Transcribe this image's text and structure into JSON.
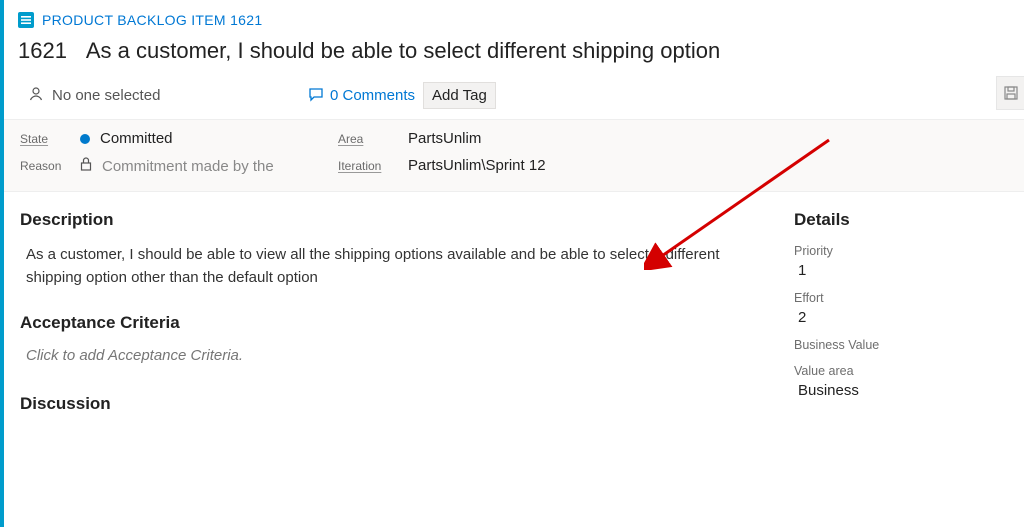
{
  "header": {
    "type_label": "PRODUCT BACKLOG ITEM",
    "id": "1621",
    "title": "As a customer, I should be able to select different shipping option"
  },
  "meta": {
    "assignee": "No one selected",
    "comments": "0 Comments",
    "add_tag": "Add Tag"
  },
  "fields": {
    "state_label": "State",
    "state_value": "Committed",
    "reason_label": "Reason",
    "reason_value": "Commitment made by the",
    "area_label": "Area",
    "area_value": "PartsUnlim",
    "iteration_label": "Iteration",
    "iteration_value": "PartsUnlim\\Sprint 12"
  },
  "sections": {
    "description_heading": "Description",
    "description_text": "As a customer, I should be able to view all the shipping options available and be able to select a different shipping option other than the default option",
    "acceptance_heading": "Acceptance Criteria",
    "acceptance_placeholder": "Click to add Acceptance Criteria.",
    "discussion_heading": "Discussion"
  },
  "details": {
    "heading": "Details",
    "priority_label": "Priority",
    "priority_value": "1",
    "effort_label": "Effort",
    "effort_value": "2",
    "bv_label": "Business Value",
    "bv_value": "",
    "va_label": "Value area",
    "va_value": "Business"
  }
}
